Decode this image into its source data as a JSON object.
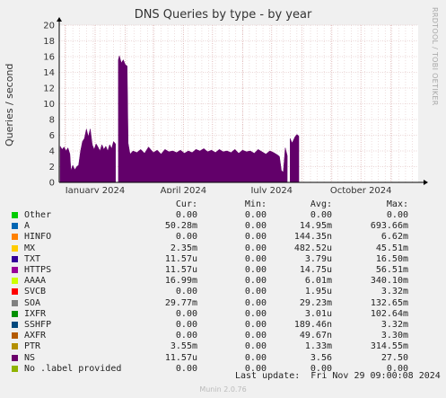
{
  "chart_data": {
    "type": "area",
    "title": "DNS Queries by type - by year",
    "ylabel": "Queries / second",
    "watermark": "RRDTOOL / TOBI OETIKER",
    "ylim": [
      0,
      20
    ],
    "yticks": [
      "0",
      "2",
      "4",
      "6",
      "8",
      "10",
      "12",
      "14",
      "16",
      "18",
      "20"
    ],
    "xticks": [
      {
        "label": "January 2024",
        "date": "2024-01-01"
      },
      {
        "label": "April 2024",
        "date": "2024-04-01"
      },
      {
        "label": "July 2024",
        "date": "2024-07-01"
      },
      {
        "label": "October 2024",
        "date": "2024-10-01"
      }
    ],
    "x_start": "2023-11-25",
    "x_end": "2024-11-29",
    "colors": {
      "background": "#f0f0f0",
      "plot": "#ffffff",
      "grid": "#e3c8c8",
      "axis": "#000000",
      "area": "#62006a"
    },
    "series": [
      {
        "name": "NS",
        "color": "#62006a",
        "points": [
          [
            "2023-11-26",
            4.6
          ],
          [
            "2023-11-28",
            4.2
          ],
          [
            "2023-11-30",
            4.5
          ],
          [
            "2023-12-02",
            4.0
          ],
          [
            "2023-12-04",
            4.4
          ],
          [
            "2023-12-06",
            3.6
          ],
          [
            "2023-12-07",
            1.5
          ],
          [
            "2023-12-09",
            2.2
          ],
          [
            "2023-12-11",
            1.6
          ],
          [
            "2023-12-13",
            2.0
          ],
          [
            "2023-12-15",
            2.2
          ],
          [
            "2023-12-17",
            4.0
          ],
          [
            "2023-12-19",
            5.2
          ],
          [
            "2023-12-21",
            5.6
          ],
          [
            "2023-12-23",
            6.8
          ],
          [
            "2023-12-25",
            5.8
          ],
          [
            "2023-12-27",
            6.8
          ],
          [
            "2023-12-29",
            4.8
          ],
          [
            "2023-12-31",
            4.2
          ],
          [
            "2024-01-02",
            4.9
          ],
          [
            "2024-01-04",
            4.5
          ],
          [
            "2024-01-06",
            4.0
          ],
          [
            "2024-01-08",
            4.8
          ],
          [
            "2024-01-10",
            4.2
          ],
          [
            "2024-01-12",
            4.6
          ],
          [
            "2024-01-14",
            4.0
          ],
          [
            "2024-01-16",
            4.8
          ],
          [
            "2024-01-18",
            4.3
          ],
          [
            "2024-01-20",
            5.2
          ],
          [
            "2024-01-22",
            4.9
          ],
          [
            "2024-01-25",
            15.6
          ],
          [
            "2024-01-26",
            16.1
          ],
          [
            "2024-01-28",
            15.2
          ],
          [
            "2024-01-30",
            15.6
          ],
          [
            "2024-02-01",
            15.0
          ],
          [
            "2024-02-03",
            14.8
          ],
          [
            "2024-02-04",
            5.0
          ],
          [
            "2024-02-06",
            3.6
          ],
          [
            "2024-02-09",
            4.0
          ],
          [
            "2024-02-13",
            3.8
          ],
          [
            "2024-02-17",
            4.2
          ],
          [
            "2024-02-21",
            3.7
          ],
          [
            "2024-02-25",
            4.5
          ],
          [
            "2024-03-01",
            3.8
          ],
          [
            "2024-03-05",
            4.1
          ],
          [
            "2024-03-09",
            3.6
          ],
          [
            "2024-03-13",
            4.2
          ],
          [
            "2024-03-17",
            3.9
          ],
          [
            "2024-03-21",
            4.0
          ],
          [
            "2024-03-25",
            3.8
          ],
          [
            "2024-03-29",
            4.1
          ],
          [
            "2024-04-02",
            3.7
          ],
          [
            "2024-04-06",
            4.0
          ],
          [
            "2024-04-10",
            3.8
          ],
          [
            "2024-04-14",
            4.2
          ],
          [
            "2024-04-18",
            4.0
          ],
          [
            "2024-04-22",
            4.3
          ],
          [
            "2024-04-26",
            3.9
          ],
          [
            "2024-04-30",
            4.1
          ],
          [
            "2024-05-04",
            3.8
          ],
          [
            "2024-05-08",
            4.2
          ],
          [
            "2024-05-12",
            3.9
          ],
          [
            "2024-05-16",
            4.0
          ],
          [
            "2024-05-20",
            3.8
          ],
          [
            "2024-05-24",
            4.2
          ],
          [
            "2024-05-28",
            3.7
          ],
          [
            "2024-06-01",
            4.1
          ],
          [
            "2024-06-05",
            3.9
          ],
          [
            "2024-06-09",
            4.0
          ],
          [
            "2024-06-13",
            3.7
          ],
          [
            "2024-06-17",
            4.2
          ],
          [
            "2024-06-21",
            3.9
          ],
          [
            "2024-06-25",
            3.6
          ],
          [
            "2024-06-29",
            4.0
          ],
          [
            "2024-07-03",
            3.8
          ],
          [
            "2024-07-07",
            3.5
          ],
          [
            "2024-07-09",
            3.3
          ],
          [
            "2024-07-11",
            1.5
          ],
          [
            "2024-07-13",
            1.3
          ],
          [
            "2024-07-15",
            4.4
          ],
          [
            "2024-07-17",
            3.4
          ],
          [
            "2024-07-20",
            5.6
          ],
          [
            "2024-07-22",
            5.0
          ],
          [
            "2024-07-25",
            5.8
          ],
          [
            "2024-07-27",
            6.1
          ],
          [
            "2024-07-29",
            5.9
          ]
        ],
        "gaps": [
          [
            "2024-01-23",
            "2024-01-24"
          ],
          [
            "2024-07-18",
            "2024-07-19"
          ]
        ]
      }
    ]
  },
  "legend": {
    "headers": {
      "cur": "Cur:",
      "min": "Min:",
      "avg": "Avg:",
      "max": "Max:"
    },
    "rows": [
      {
        "name": "Other",
        "color": "#00cc00",
        "cur": "0.00",
        "min": "0.00",
        "avg": "0.00",
        "max": "0.00"
      },
      {
        "name": "A",
        "color": "#0066b3",
        "cur": "50.28m",
        "min": "0.00",
        "avg": "14.95m",
        "max": "693.66m"
      },
      {
        "name": "HINFO",
        "color": "#ff8000",
        "cur": "0.00",
        "min": "0.00",
        "avg": "144.35n",
        "max": "6.62m"
      },
      {
        "name": "MX",
        "color": "#ffcc00",
        "cur": "2.35m",
        "min": "0.00",
        "avg": "482.52u",
        "max": "45.51m"
      },
      {
        "name": "TXT",
        "color": "#330099",
        "cur": "11.57u",
        "min": "0.00",
        "avg": "3.79u",
        "max": "16.50m"
      },
      {
        "name": "HTTPS",
        "color": "#990099",
        "cur": "11.57u",
        "min": "0.00",
        "avg": "14.75u",
        "max": "56.51m"
      },
      {
        "name": "AAAA",
        "color": "#ccff00",
        "cur": "16.99m",
        "min": "0.00",
        "avg": "6.01m",
        "max": "340.10m"
      },
      {
        "name": "SVCB",
        "color": "#ff0000",
        "cur": "0.00",
        "min": "0.00",
        "avg": "1.95u",
        "max": "3.32m"
      },
      {
        "name": "SOA",
        "color": "#808080",
        "cur": "29.77m",
        "min": "0.00",
        "avg": "29.23m",
        "max": "132.65m"
      },
      {
        "name": "IXFR",
        "color": "#008f00",
        "cur": "0.00",
        "min": "0.00",
        "avg": "3.01u",
        "max": "102.64m"
      },
      {
        "name": "SSHFP",
        "color": "#00487d",
        "cur": "0.00",
        "min": "0.00",
        "avg": "189.46n",
        "max": "3.32m"
      },
      {
        "name": "AXFR",
        "color": "#b35a00",
        "cur": "0.00",
        "min": "0.00",
        "avg": "49.67n",
        "max": "3.30m"
      },
      {
        "name": "PTR",
        "color": "#b38f00",
        "cur": "3.55m",
        "min": "0.00",
        "avg": "1.33m",
        "max": "314.55m"
      },
      {
        "name": "NS",
        "color": "#6b006b",
        "cur": "11.57u",
        "min": "0.00",
        "avg": "3.56",
        "max": "27.50"
      },
      {
        "name": "No .label provided",
        "color": "#8fb300",
        "cur": "0.00",
        "min": "0.00",
        "avg": "0.00",
        "max": "0.00"
      }
    ]
  },
  "footer": {
    "last_update": "Last update:  Fri Nov 29 09:00:08 2024",
    "version": "Munin 2.0.76"
  }
}
